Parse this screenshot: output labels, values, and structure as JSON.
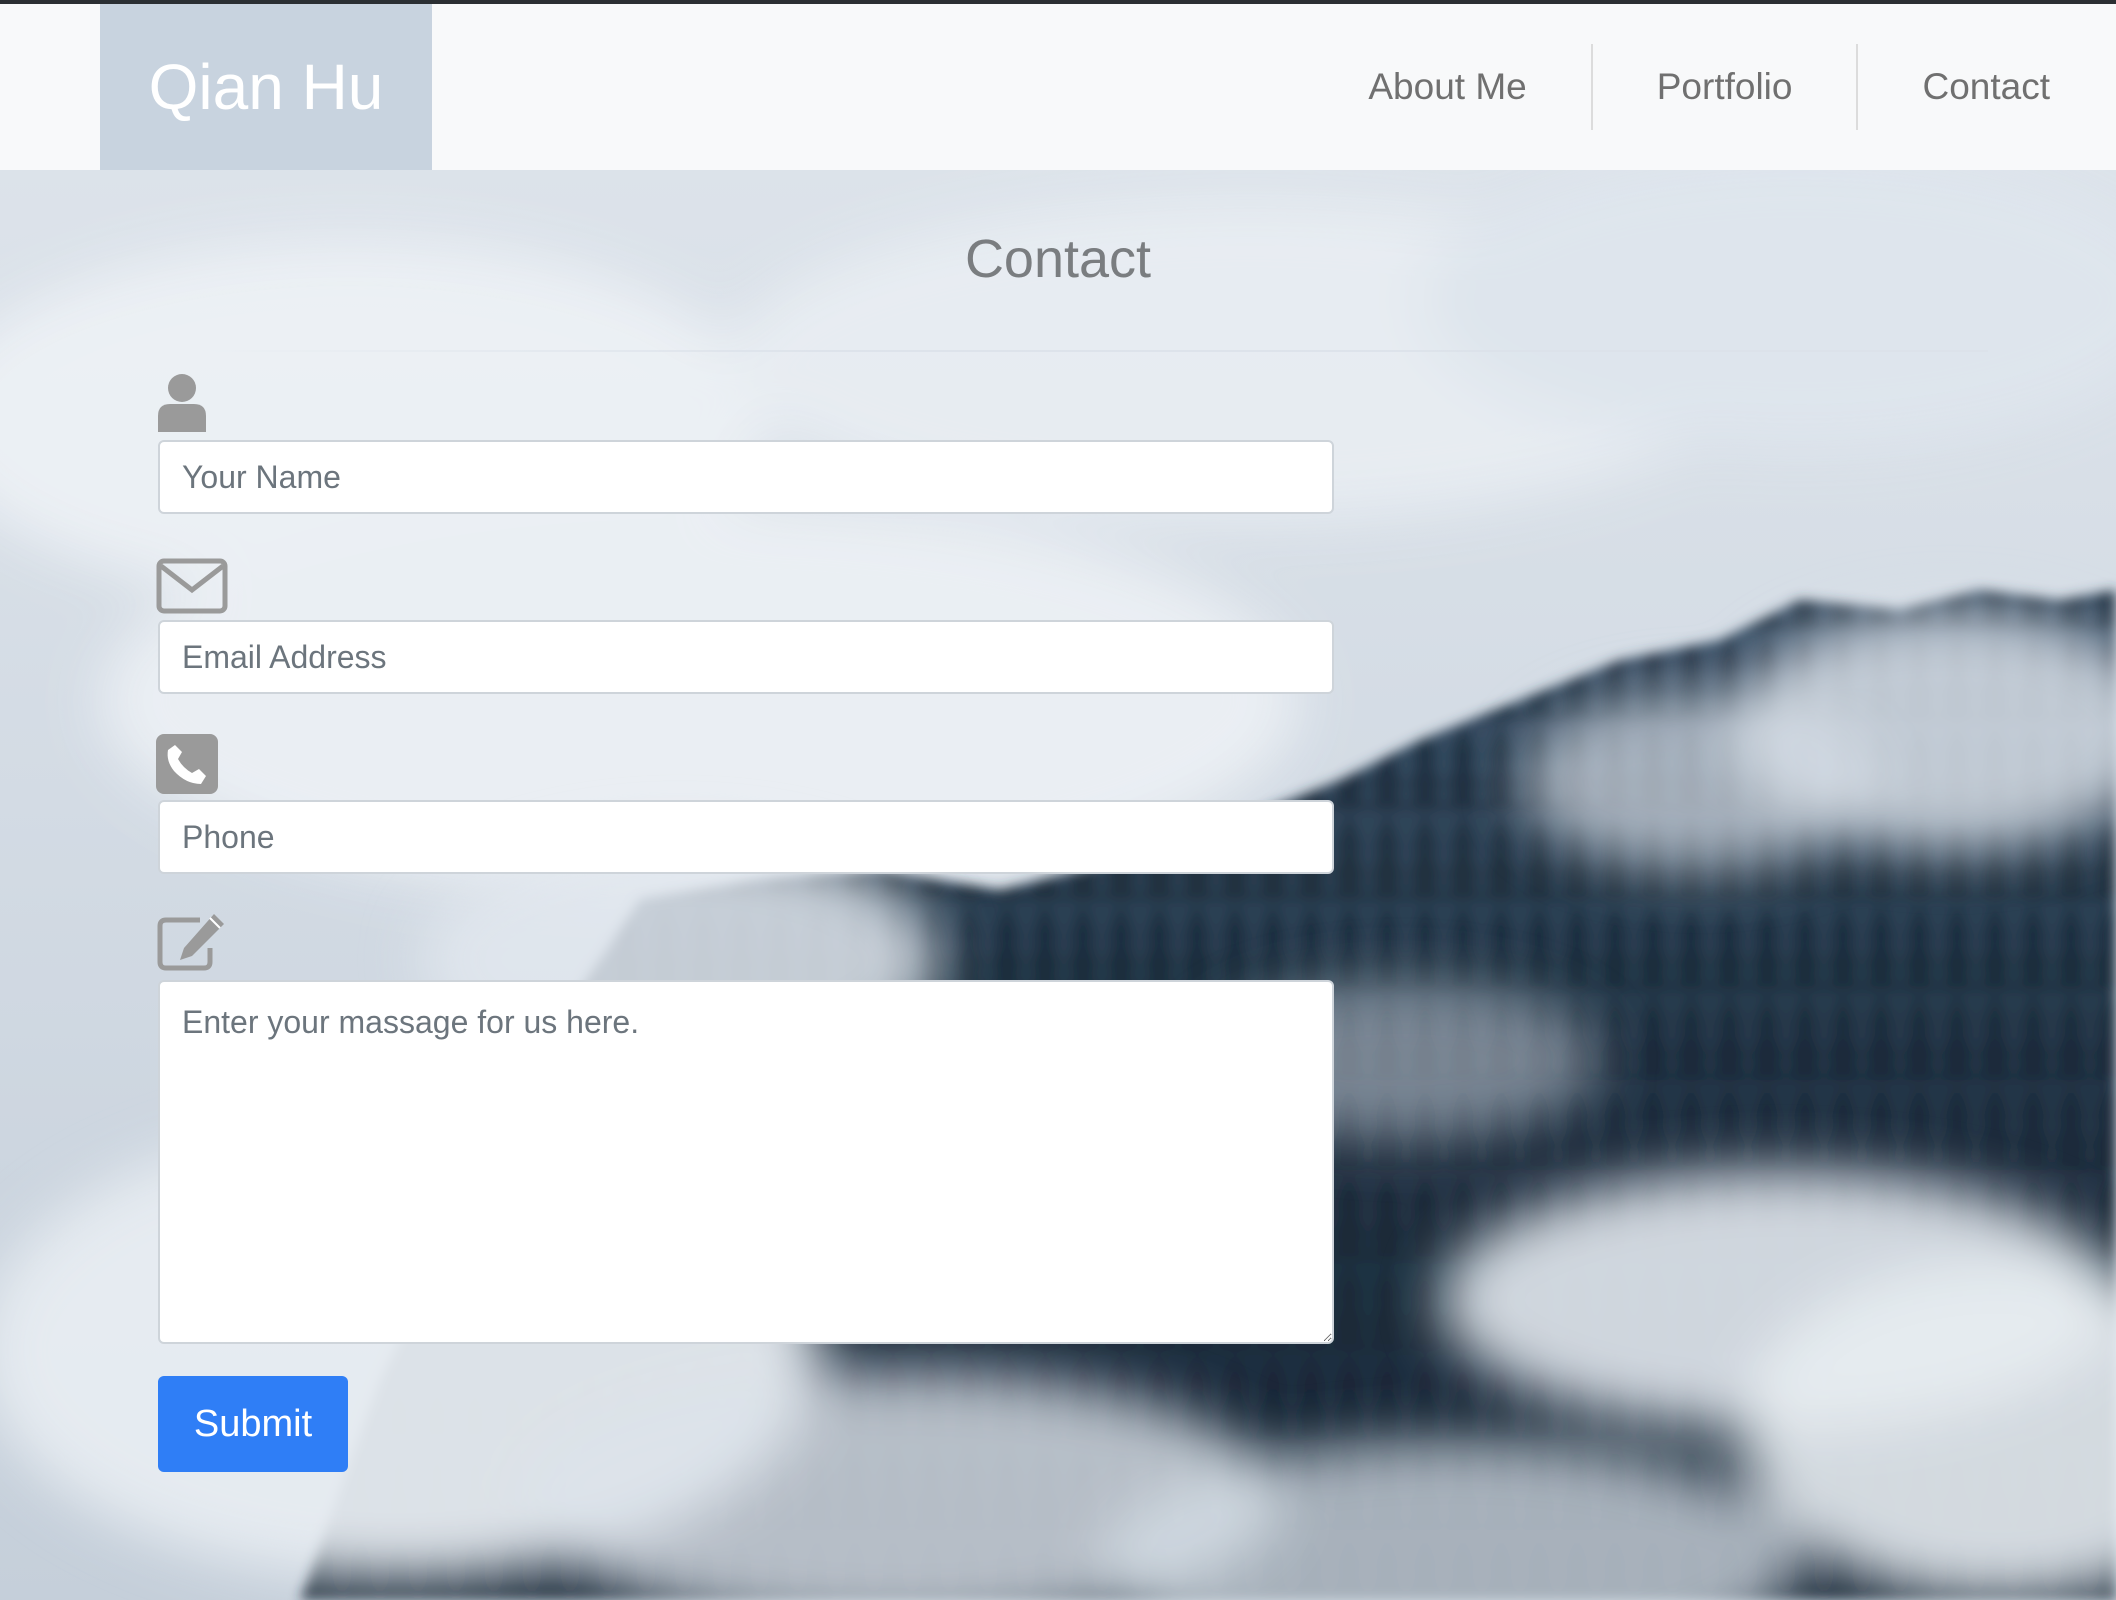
{
  "colors": {
    "navbar_bg": "#f8f9fa",
    "brand_bg": "#c8d3df",
    "brand_text": "#ffffff",
    "nav_text": "#707070",
    "heading_text": "#7a7d80",
    "icon": "#9a9a9a",
    "submit_bg": "#2f7ef6"
  },
  "navbar": {
    "brand": "Qian Hu",
    "links": [
      {
        "label": "About Me"
      },
      {
        "label": "Portfolio"
      },
      {
        "label": "Contact"
      }
    ]
  },
  "main": {
    "title": "Contact",
    "form": {
      "name": {
        "icon": "user-icon",
        "placeholder": "Your Name",
        "value": ""
      },
      "email": {
        "icon": "envelope-icon",
        "placeholder": "Email Address",
        "value": ""
      },
      "phone": {
        "icon": "phone-icon",
        "placeholder": "Phone",
        "value": ""
      },
      "message": {
        "icon": "edit-icon",
        "placeholder": "Enter your massage for us here.",
        "value": ""
      },
      "submit_label": "Submit"
    }
  }
}
